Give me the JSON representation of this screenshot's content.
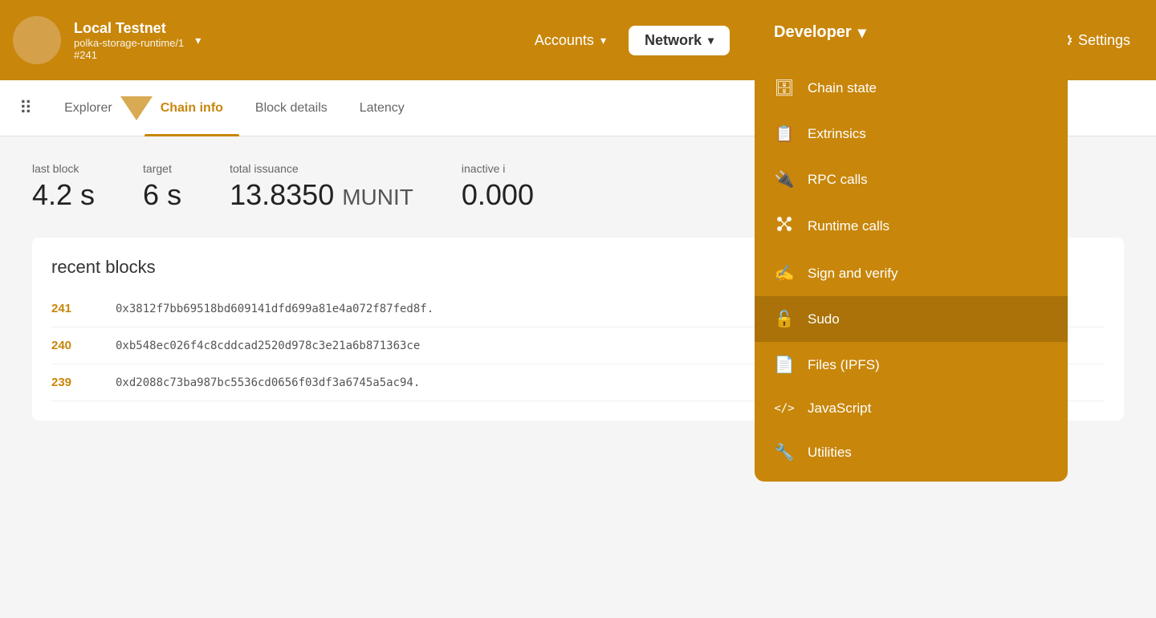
{
  "navbar": {
    "network_name": "Local Testnet",
    "chain": "polka-storage-runtime/1",
    "block": "#241",
    "accounts_label": "Accounts",
    "network_label": "Network",
    "developer_label": "Developer",
    "settings_label": "Settings"
  },
  "sub_nav": {
    "explorer_label": "Explorer",
    "chain_info_label": "Chain info",
    "block_details_label": "Block details",
    "latency_label": "Latency"
  },
  "stats": {
    "last_block_label": "last block",
    "last_block_value": "4.2 s",
    "target_label": "target",
    "target_value": "6 s",
    "total_issuance_label": "total issuance",
    "total_issuance_value": "13.8350",
    "total_issuance_unit": "MUNIT",
    "inactive_label": "inactive i",
    "inactive_value": "0.000"
  },
  "recent_blocks": {
    "title": "recent blocks",
    "rows": [
      {
        "number": "241",
        "hash": "0x3812f7bb69518bd609141dfd699a81e4a072f87fed8f."
      },
      {
        "number": "240",
        "hash": "0xb548ec026f4c8cddcad2520d978c3e21a6b871363ce"
      },
      {
        "number": "239",
        "hash": "0xd2088c73ba987bc5536cd0656f03df3a6745a5ac94."
      }
    ]
  },
  "developer_menu": {
    "items": [
      {
        "icon": "🗄",
        "label": "Chain state",
        "selected": false
      },
      {
        "icon": "📋",
        "label": "Extrinsics",
        "selected": false
      },
      {
        "icon": "🔌",
        "label": "RPC calls",
        "selected": false
      },
      {
        "icon": "⚙",
        "label": "Runtime calls",
        "selected": false
      },
      {
        "icon": "✍",
        "label": "Sign and verify",
        "selected": false
      },
      {
        "icon": "🔓",
        "label": "Sudo",
        "selected": true
      },
      {
        "icon": "📄",
        "label": "Files (IPFS)",
        "selected": false
      },
      {
        "icon": "</>",
        "label": "JavaScript",
        "selected": false
      },
      {
        "icon": "🔧",
        "label": "Utilities",
        "selected": false
      }
    ]
  },
  "colors": {
    "orange": "#c8860a",
    "orange_light": "#d4a04a"
  }
}
